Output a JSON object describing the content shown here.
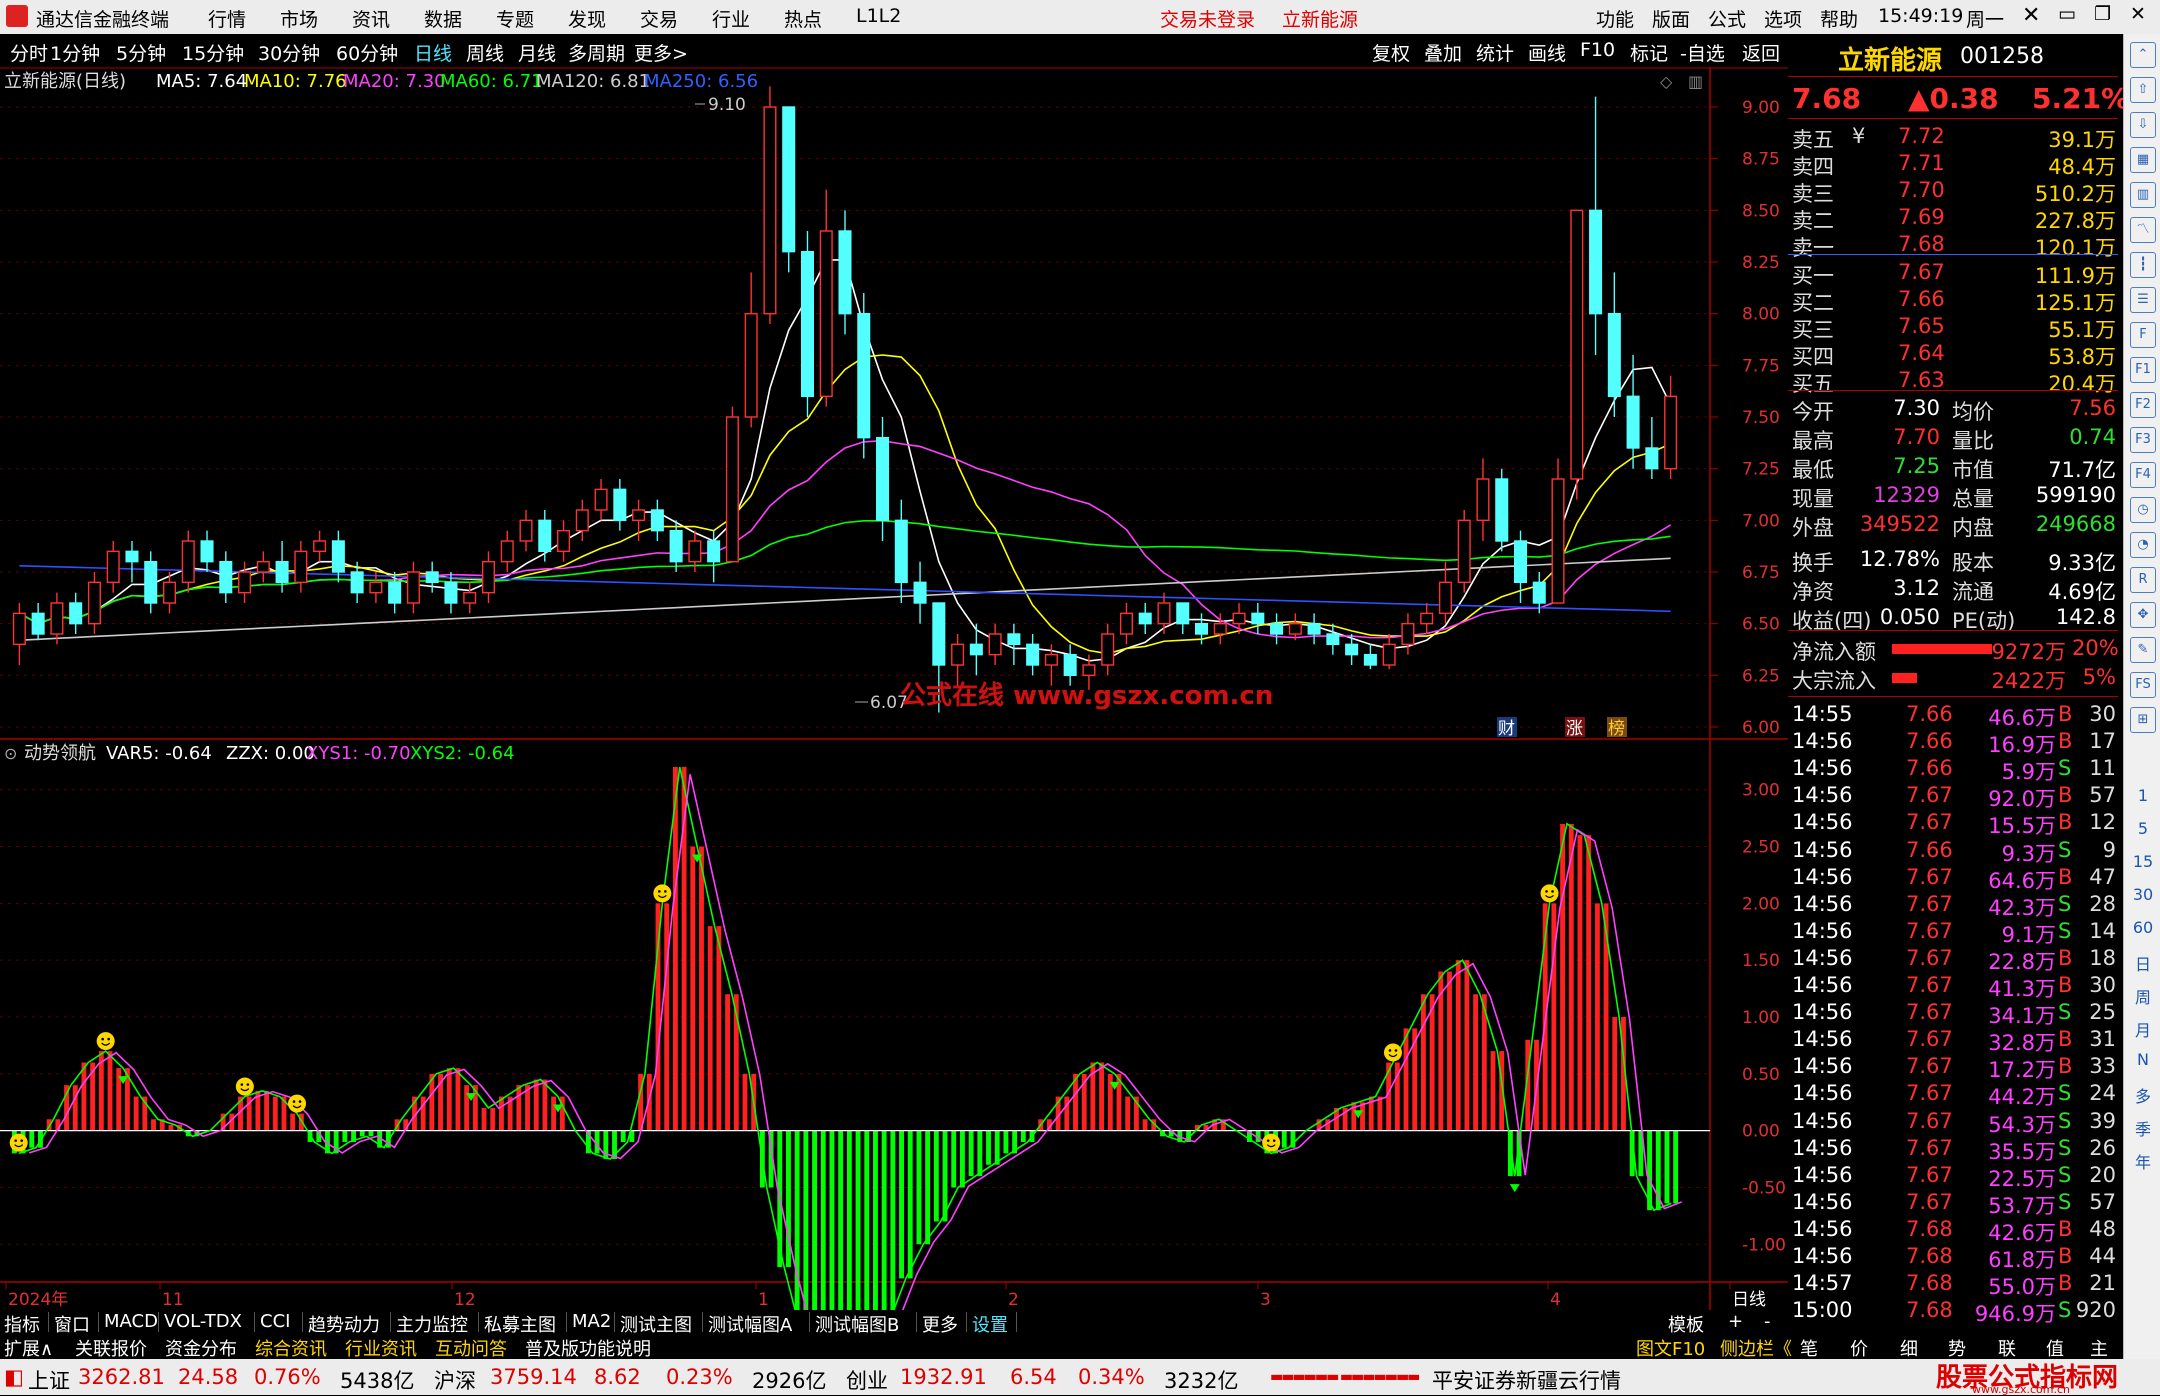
{
  "titlebar": {
    "app_name": "通达信金融终端",
    "menus": [
      "行情",
      "市场",
      "资讯",
      "数据",
      "专题",
      "发现",
      "交易",
      "行业",
      "热点",
      "L1L2"
    ],
    "trade_status": "交易未登录",
    "stock_name": "立新能源",
    "right_menus": [
      "功能",
      "版面",
      "公式",
      "选项",
      "帮助"
    ],
    "time": "15:49:19",
    "weekday": "周一"
  },
  "periods": {
    "items": [
      "分时",
      "1分钟",
      "5分钟",
      "15分钟",
      "30分钟",
      "60分钟",
      "日线",
      "周线",
      "月线",
      "多周期",
      "更多>"
    ],
    "selected": "日线",
    "right_tools": [
      "复权",
      "叠加",
      "统计",
      "画线",
      "F10",
      "标记",
      "-自选",
      "返回"
    ]
  },
  "main_legend": {
    "title": "立新能源(日线)",
    "ma5": "MA5: 7.64",
    "ma10": "MA10: 7.76",
    "ma20": "MA20: 7.30",
    "ma60": "MA60: 6.71",
    "ma120": "MA120: 6.81",
    "ma250": "MA250: 6.56"
  },
  "annotations": {
    "high": "9.10",
    "low": "6.07",
    "watermark": "公式在线  www.gszx.com.cn",
    "badge_cai": "财",
    "badge_zhang": "涨",
    "badge_bang": "榜"
  },
  "sub_legend": {
    "title": "动势领航",
    "var5": "VAR5: -0.64",
    "zzx": "ZZX: 0.00",
    "xys1": "XYS1: -0.70",
    "xys2": "XYS2: -0.64"
  },
  "chart_data": [
    {
      "type": "candlestick",
      "title": "立新能源(日线)",
      "y_ticks": [
        "9.00",
        "8.75",
        "8.50",
        "8.25",
        "8.00",
        "7.75",
        "7.50",
        "7.25",
        "7.00",
        "6.75",
        "6.50",
        "6.25",
        "6.00"
      ],
      "x_ticks": [
        "2024年",
        "11",
        "12",
        "1",
        "2",
        "3",
        "4",
        "日线"
      ],
      "ylim": [
        6.0,
        9.0
      ],
      "candles": [
        [
          6.4,
          6.55,
          6.3,
          6.6
        ],
        [
          6.55,
          6.45,
          6.42,
          6.6
        ],
        [
          6.45,
          6.6,
          6.4,
          6.65
        ],
        [
          6.6,
          6.5,
          6.45,
          6.65
        ],
        [
          6.5,
          6.7,
          6.45,
          6.75
        ],
        [
          6.7,
          6.85,
          6.65,
          6.9
        ],
        [
          6.85,
          6.8,
          6.7,
          6.9
        ],
        [
          6.8,
          6.6,
          6.55,
          6.85
        ],
        [
          6.6,
          6.7,
          6.55,
          6.75
        ],
        [
          6.7,
          6.9,
          6.65,
          6.95
        ],
        [
          6.9,
          6.8,
          6.75,
          6.95
        ],
        [
          6.8,
          6.65,
          6.6,
          6.85
        ],
        [
          6.65,
          6.75,
          6.6,
          6.8
        ],
        [
          6.75,
          6.8,
          6.7,
          6.85
        ],
        [
          6.8,
          6.7,
          6.65,
          6.9
        ],
        [
          6.7,
          6.85,
          6.65,
          6.9
        ],
        [
          6.85,
          6.9,
          6.8,
          6.95
        ],
        [
          6.9,
          6.75,
          6.7,
          6.95
        ],
        [
          6.75,
          6.65,
          6.6,
          6.8
        ],
        [
          6.65,
          6.7,
          6.6,
          6.75
        ],
        [
          6.7,
          6.6,
          6.55,
          6.75
        ],
        [
          6.6,
          6.75,
          6.55,
          6.8
        ],
        [
          6.75,
          6.7,
          6.65,
          6.8
        ],
        [
          6.7,
          6.6,
          6.55,
          6.75
        ],
        [
          6.6,
          6.65,
          6.55,
          6.7
        ],
        [
          6.65,
          6.8,
          6.6,
          6.85
        ],
        [
          6.8,
          6.9,
          6.75,
          6.95
        ],
        [
          6.9,
          7.0,
          6.85,
          7.05
        ],
        [
          7.0,
          6.85,
          6.8,
          7.05
        ],
        [
          6.85,
          6.95,
          6.8,
          7.0
        ],
        [
          6.95,
          7.05,
          6.9,
          7.1
        ],
        [
          7.05,
          7.15,
          7.0,
          7.2
        ],
        [
          7.15,
          7.0,
          6.95,
          7.2
        ],
        [
          7.0,
          7.05,
          6.9,
          7.1
        ],
        [
          7.05,
          6.95,
          6.9,
          7.1
        ],
        [
          6.95,
          6.8,
          6.75,
          7.0
        ],
        [
          6.8,
          6.9,
          6.75,
          6.95
        ],
        [
          6.9,
          6.8,
          6.7,
          6.95
        ],
        [
          6.8,
          7.5,
          6.8,
          7.55
        ],
        [
          7.5,
          8.0,
          7.45,
          8.2
        ],
        [
          8.0,
          9.0,
          7.95,
          9.1
        ],
        [
          9.0,
          8.3,
          8.2,
          9.0
        ],
        [
          8.3,
          7.6,
          7.5,
          8.4
        ],
        [
          7.6,
          8.4,
          7.55,
          8.6
        ],
        [
          8.4,
          8.0,
          7.9,
          8.5
        ],
        [
          8.0,
          7.4,
          7.3,
          8.1
        ],
        [
          7.4,
          7.0,
          6.9,
          7.5
        ],
        [
          7.0,
          6.7,
          6.6,
          7.1
        ],
        [
          6.7,
          6.6,
          6.5,
          6.8
        ],
        [
          6.6,
          6.3,
          6.07,
          6.6
        ],
        [
          6.3,
          6.4,
          6.2,
          6.45
        ],
        [
          6.4,
          6.35,
          6.25,
          6.5
        ],
        [
          6.35,
          6.45,
          6.3,
          6.5
        ],
        [
          6.45,
          6.4,
          6.3,
          6.5
        ],
        [
          6.4,
          6.3,
          6.25,
          6.45
        ],
        [
          6.3,
          6.35,
          6.2,
          6.4
        ],
        [
          6.35,
          6.25,
          6.2,
          6.4
        ],
        [
          6.25,
          6.3,
          6.18,
          6.35
        ],
        [
          6.3,
          6.45,
          6.25,
          6.5
        ],
        [
          6.45,
          6.55,
          6.4,
          6.6
        ],
        [
          6.55,
          6.5,
          6.45,
          6.6
        ],
        [
          6.5,
          6.6,
          6.45,
          6.65
        ],
        [
          6.6,
          6.5,
          6.45,
          6.6
        ],
        [
          6.5,
          6.45,
          6.4,
          6.55
        ],
        [
          6.45,
          6.5,
          6.4,
          6.55
        ],
        [
          6.5,
          6.55,
          6.45,
          6.6
        ],
        [
          6.55,
          6.5,
          6.45,
          6.6
        ],
        [
          6.5,
          6.45,
          6.4,
          6.55
        ],
        [
          6.45,
          6.5,
          6.42,
          6.55
        ],
        [
          6.5,
          6.45,
          6.4,
          6.55
        ],
        [
          6.45,
          6.4,
          6.35,
          6.5
        ],
        [
          6.4,
          6.35,
          6.3,
          6.45
        ],
        [
          6.35,
          6.3,
          6.28,
          6.4
        ],
        [
          6.3,
          6.4,
          6.28,
          6.45
        ],
        [
          6.4,
          6.5,
          6.35,
          6.55
        ],
        [
          6.5,
          6.55,
          6.45,
          6.6
        ],
        [
          6.55,
          6.7,
          6.5,
          6.8
        ],
        [
          6.7,
          7.0,
          6.65,
          7.05
        ],
        [
          7.0,
          7.2,
          6.9,
          7.3
        ],
        [
          7.2,
          6.9,
          6.85,
          7.25
        ],
        [
          6.9,
          6.7,
          6.6,
          6.95
        ],
        [
          6.7,
          6.6,
          6.55,
          6.75
        ],
        [
          6.6,
          7.2,
          6.6,
          7.3
        ],
        [
          7.2,
          8.5,
          7.1,
          8.5
        ],
        [
          8.5,
          8.0,
          7.8,
          9.05
        ],
        [
          8.0,
          7.6,
          7.5,
          8.2
        ],
        [
          7.6,
          7.35,
          7.25,
          7.8
        ],
        [
          7.35,
          7.25,
          7.2,
          7.5
        ],
        [
          7.25,
          7.6,
          7.2,
          7.7
        ]
      ]
    },
    {
      "type": "bar",
      "title": "动势领航",
      "y_ticks": [
        "3.00",
        "2.50",
        "2.00",
        "1.50",
        "1.00",
        "0.50",
        "0.00",
        "-0.50",
        "-1.00"
      ],
      "ylim": [
        -1.2,
        3.2
      ],
      "series": [
        {
          "name": "VAR5",
          "values": [
            -0.2,
            -0.15,
            0.1,
            0.4,
            0.6,
            0.7,
            0.55,
            0.3,
            0.1,
            0.05,
            -0.05,
            0.0,
            0.15,
            0.3,
            0.35,
            0.3,
            0.15,
            -0.1,
            -0.2,
            -0.1,
            -0.05,
            -0.15,
            0.1,
            0.3,
            0.5,
            0.55,
            0.4,
            0.2,
            0.3,
            0.4,
            0.45,
            0.3,
            0.0,
            -0.2,
            -0.25,
            -0.1,
            0.5,
            2.0,
            3.2,
            2.5,
            1.8,
            1.2,
            0.5,
            -0.5,
            -1.2,
            -1.8,
            -2.2,
            -2.4,
            -2.3,
            -2.0,
            -1.7,
            -1.3,
            -1.0,
            -0.8,
            -0.5,
            -0.4,
            -0.3,
            -0.2,
            -0.1,
            0.1,
            0.3,
            0.5,
            0.6,
            0.5,
            0.3,
            0.1,
            -0.05,
            -0.1,
            0.05,
            0.1,
            0.0,
            -0.1,
            -0.2,
            -0.15,
            0.0,
            0.1,
            0.2,
            0.25,
            0.3,
            0.6,
            0.9,
            1.2,
            1.4,
            1.5,
            1.2,
            0.7,
            -0.4,
            0.8,
            2.0,
            2.7,
            2.6,
            2.0,
            1.0,
            -0.4,
            -0.7,
            -0.64
          ]
        },
        {
          "name": "XYS1",
          "values": []
        },
        {
          "name": "XYS2",
          "values": []
        }
      ]
    }
  ],
  "quote": {
    "name": "立新能源",
    "code": "001258",
    "price": "7.68",
    "change": "▲0.38",
    "change_pct": "5.21%",
    "asks": [
      {
        "label": "卖五",
        "price": "7.72",
        "vol": "39.1万"
      },
      {
        "label": "卖四",
        "price": "7.71",
        "vol": "48.4万"
      },
      {
        "label": "卖三",
        "price": "7.70",
        "vol": "510.2万"
      },
      {
        "label": "卖二",
        "price": "7.69",
        "vol": "227.8万"
      },
      {
        "label": "卖一",
        "price": "7.68",
        "vol": "120.1万"
      }
    ],
    "ask_mark": "¥",
    "bids": [
      {
        "label": "买一",
        "price": "7.67",
        "vol": "111.9万"
      },
      {
        "label": "买二",
        "price": "7.66",
        "vol": "125.1万"
      },
      {
        "label": "买三",
        "price": "7.65",
        "vol": "55.1万"
      },
      {
        "label": "买四",
        "price": "7.64",
        "vol": "53.8万"
      },
      {
        "label": "买五",
        "price": "7.63",
        "vol": "20.4万"
      }
    ],
    "stats": [
      {
        "l1": "今开",
        "v1": "7.30",
        "l2": "均价",
        "v2": "7.56",
        "c1": "#fff",
        "c2": "#ff3030"
      },
      {
        "l1": "最高",
        "v1": "7.70",
        "l2": "量比",
        "v2": "0.74",
        "c1": "#ff3030",
        "c2": "#2ee02e"
      },
      {
        "l1": "最低",
        "v1": "7.25",
        "l2": "市值",
        "v2": "71.7亿",
        "c1": "#2ee02e",
        "c2": "#fff"
      },
      {
        "l1": "现量",
        "v1": "12329",
        "l2": "总量",
        "v2": "599190",
        "c1": "#e040e0",
        "c2": "#fff"
      },
      {
        "l1": "外盘",
        "v1": "349522",
        "l2": "内盘",
        "v2": "249668",
        "c1": "#ff3030",
        "c2": "#2ee02e"
      },
      {
        "l1": "换手",
        "v1": "12.78%",
        "l2": "股本",
        "v2": "9.33亿",
        "c1": "#fff",
        "c2": "#fff"
      },
      {
        "l1": "净资",
        "v1": "3.12",
        "l2": "流通",
        "v2": "4.69亿",
        "c1": "#fff",
        "c2": "#fff"
      },
      {
        "l1": "收益(四)",
        "v1": "0.050",
        "l2": "PE(动)",
        "v2": "142.8",
        "c1": "#fff",
        "c2": "#fff"
      }
    ],
    "flows": [
      {
        "label": "净流入额",
        "value": "9272万",
        "pct": "20%",
        "bar": 0.2
      },
      {
        "label": "大宗流入",
        "value": "2422万",
        "pct": "5%",
        "bar": 0.05
      }
    ],
    "ticks": [
      {
        "t": "14:55",
        "p": "7.66",
        "v": "46.6万",
        "d": "B",
        "n": "30"
      },
      {
        "t": "14:56",
        "p": "7.66",
        "v": "16.9万",
        "d": "B",
        "n": "17"
      },
      {
        "t": "14:56",
        "p": "7.66",
        "v": "5.9万",
        "d": "S",
        "n": "11"
      },
      {
        "t": "14:56",
        "p": "7.67",
        "v": "92.0万",
        "d": "B",
        "n": "57"
      },
      {
        "t": "14:56",
        "p": "7.67",
        "v": "15.5万",
        "d": "B",
        "n": "12"
      },
      {
        "t": "14:56",
        "p": "7.66",
        "v": "9.3万",
        "d": "S",
        "n": "9"
      },
      {
        "t": "14:56",
        "p": "7.67",
        "v": "64.6万",
        "d": "B",
        "n": "47"
      },
      {
        "t": "14:56",
        "p": "7.67",
        "v": "42.3万",
        "d": "S",
        "n": "28"
      },
      {
        "t": "14:56",
        "p": "7.67",
        "v": "9.1万",
        "d": "S",
        "n": "14"
      },
      {
        "t": "14:56",
        "p": "7.67",
        "v": "22.8万",
        "d": "B",
        "n": "18"
      },
      {
        "t": "14:56",
        "p": "7.67",
        "v": "41.3万",
        "d": "B",
        "n": "30"
      },
      {
        "t": "14:56",
        "p": "7.67",
        "v": "34.1万",
        "d": "S",
        "n": "25"
      },
      {
        "t": "14:56",
        "p": "7.67",
        "v": "32.8万",
        "d": "B",
        "n": "31"
      },
      {
        "t": "14:56",
        "p": "7.67",
        "v": "17.2万",
        "d": "B",
        "n": "33"
      },
      {
        "t": "14:56",
        "p": "7.67",
        "v": "44.2万",
        "d": "S",
        "n": "24"
      },
      {
        "t": "14:56",
        "p": "7.67",
        "v": "54.3万",
        "d": "S",
        "n": "39"
      },
      {
        "t": "14:56",
        "p": "7.67",
        "v": "35.5万",
        "d": "S",
        "n": "26"
      },
      {
        "t": "14:56",
        "p": "7.67",
        "v": "22.5万",
        "d": "S",
        "n": "20"
      },
      {
        "t": "14:56",
        "p": "7.67",
        "v": "53.7万",
        "d": "S",
        "n": "57"
      },
      {
        "t": "14:56",
        "p": "7.68",
        "v": "42.6万",
        "d": "B",
        "n": "48"
      },
      {
        "t": "14:56",
        "p": "7.68",
        "v": "61.8万",
        "d": "B",
        "n": "44"
      },
      {
        "t": "14:57",
        "p": "7.68",
        "v": "55.0万",
        "d": "B",
        "n": "21"
      },
      {
        "t": "15:00",
        "p": "7.68",
        "v": "946.9万",
        "d": "S",
        "n": "920"
      }
    ]
  },
  "sidebar": {
    "icons": [
      "chevron-up-icon",
      "arrow-up-icon",
      "arrow-down-icon",
      "grid-icon",
      "bars-icon",
      "line-icon",
      "candles-icon",
      "list-icon",
      "f10-icon",
      "f1-icon",
      "f2-icon",
      "f3-icon",
      "f4-icon",
      "clock-icon",
      "pie-icon",
      "rsi-icon",
      "move-icon",
      "pen-icon",
      "fs-icon",
      "chart-icon"
    ],
    "labels": [
      "1",
      "5",
      "15",
      "30",
      "60",
      "日",
      "周",
      "月",
      "N",
      "多",
      "季",
      "年"
    ]
  },
  "tabbar1": {
    "items": [
      "指标",
      "窗口",
      "MACD",
      "VOL-TDX",
      "CCI",
      "趋势动力",
      "主力监控",
      "私募主图",
      "MA2",
      "测试主图",
      "测试幅图A",
      "测试幅图B",
      "更多",
      "设置"
    ],
    "right": [
      "模板",
      "+",
      "-"
    ]
  },
  "tabbar2": {
    "items": [
      "扩展∧",
      "关联报价",
      "资金分布",
      "综合资讯",
      "行业资讯",
      "互动问答",
      "普及版功能说明"
    ],
    "right": [
      "图文F10",
      "侧边栏《",
      "笔",
      "价",
      "细",
      "势",
      "联",
      "值",
      "主"
    ]
  },
  "statusbar": {
    "sh_label": "上证",
    "sh_val": "3262.81",
    "sh_chg": "24.58",
    "sh_pct": "0.76%",
    "sh_amt": "5438亿",
    "hs_label": "沪深",
    "hs_val": "3759.14",
    "hs_chg": "8.62",
    "hs_pct": "0.23%",
    "hs_amt": "2926亿",
    "cy_label": "创业",
    "cy_val": "1932.91",
    "cy_chg": "6.54",
    "cy_pct": "0.34%",
    "cy_amt": "3232亿",
    "broker": "平安证券新疆云行情",
    "site": "股票公式指标网",
    "site_url": "www.gszx.com.cn"
  }
}
